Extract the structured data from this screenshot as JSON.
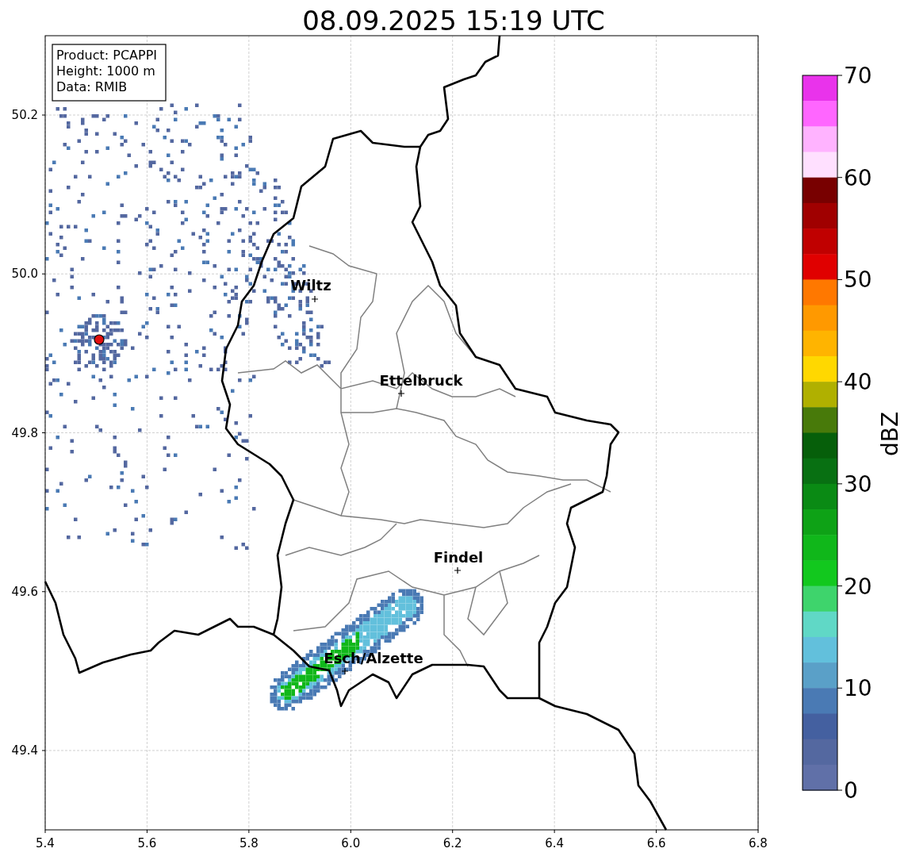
{
  "title": "08.09.2025 15:19 UTC",
  "info_box": [
    "Product: PCAPPI",
    "Height: 1000 m",
    "Data: RMIB"
  ],
  "axes": {
    "xticks": [
      "5.4",
      "5.6",
      "5.8",
      "6.0",
      "6.2",
      "6.4",
      "6.6",
      "6.8"
    ],
    "yticks": [
      "50.2",
      "50.0",
      "49.8",
      "49.6",
      "49.4"
    ]
  },
  "cities": [
    {
      "label": "Wiltz"
    },
    {
      "label": "Ettelbruck"
    },
    {
      "label": "Findel"
    },
    {
      "label": "Esch/Alzette"
    }
  ],
  "colorbar": {
    "label": "dBZ",
    "ticks": [
      "70",
      "60",
      "50",
      "40",
      "30",
      "20",
      "10",
      "0"
    ],
    "bands": [
      {
        "color": "#e933eb"
      },
      {
        "color": "#ff66ff"
      },
      {
        "color": "#ffb3ff"
      },
      {
        "color": "#ffe0ff"
      },
      {
        "color": "#780000"
      },
      {
        "color": "#a00000"
      },
      {
        "color": "#c00000"
      },
      {
        "color": "#e00000"
      },
      {
        "color": "#ff7800"
      },
      {
        "color": "#ff9900"
      },
      {
        "color": "#ffb400"
      },
      {
        "color": "#ffd800"
      },
      {
        "color": "#b0b000"
      },
      {
        "color": "#487a0a"
      },
      {
        "color": "#065f0a"
      },
      {
        "color": "#087012"
      },
      {
        "color": "#0a8a14"
      },
      {
        "color": "#0ea216"
      },
      {
        "color": "#10b71a"
      },
      {
        "color": "#12c81e"
      },
      {
        "color": "#3ed46c"
      },
      {
        "color": "#60d8c6"
      },
      {
        "color": "#62c0dc"
      },
      {
        "color": "#5aa0c8"
      },
      {
        "color": "#4a7ab4"
      },
      {
        "color": "#4460a0"
      },
      {
        "color": "#5468a0"
      },
      {
        "color": "#6070a8"
      }
    ]
  }
}
